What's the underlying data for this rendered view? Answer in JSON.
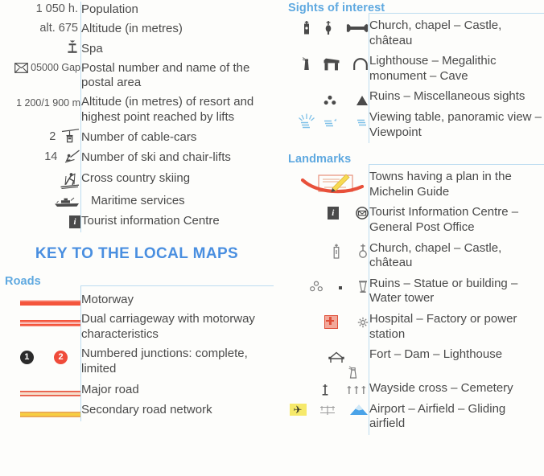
{
  "document": {
    "type": "map-legend",
    "title_local_maps": "KEY TO THE LOCAL MAPS"
  },
  "left_column": {
    "resort_rows": [
      {
        "symbol_text": "1 050 h.",
        "icon": "none",
        "label": "Population"
      },
      {
        "symbol_text": "alt. 675",
        "icon": "none",
        "label": "Altitude (in metres)"
      },
      {
        "symbol_text": "",
        "icon": "spa-fountain-icon",
        "label": "Spa"
      },
      {
        "symbol_text": "05000 Gap",
        "icon": "envelope-icon",
        "label": "Postal number and name of the postal area"
      },
      {
        "symbol_text": "1 200/1 900 m",
        "icon": "none",
        "label": "Altitude (in metres) of resort and highest point reached by lifts"
      },
      {
        "symbol_text": "2",
        "icon": "cable-car-icon",
        "label": "Number of cable-cars"
      },
      {
        "symbol_text": "14",
        "icon": "chairlift-skier-icon",
        "label": "Number of ski and chair-lifts"
      },
      {
        "symbol_text": "",
        "icon": "cross-country-skier-icon",
        "label": "Cross country skiing"
      },
      {
        "symbol_text": "",
        "icon": "ferry-boat-icon",
        "label": "Maritime services"
      },
      {
        "symbol_text": "",
        "icon": "tourist-information-icon",
        "label": "Tourist information Centre"
      }
    ],
    "roads": {
      "heading": "Roads",
      "rows": [
        {
          "icon": "motorway-swatch",
          "label": "Motorway"
        },
        {
          "icon": "dual-carriageway-swatch",
          "label": "Dual carriageway with motorway characteristics"
        },
        {
          "icon": "numbered-junction-icons",
          "junction_complete": "1",
          "junction_limited": "2",
          "label": "Numbered junctions: complete, limited"
        },
        {
          "icon": "major-road-swatch",
          "label": "Major road"
        },
        {
          "icon": "secondary-road-swatch",
          "label": "Secondary road network"
        }
      ]
    }
  },
  "right_column": {
    "sights": {
      "heading": "Sights of interest",
      "rows": [
        {
          "icons": [
            "church-icon",
            "chapel-icon",
            "castle-chateau-icon"
          ],
          "label": "Church, chapel – Castle, château"
        },
        {
          "icons": [
            "lighthouse-icon",
            "megalithic-monument-icon",
            "cave-icon"
          ],
          "label": "Lighthouse – Megalithic monument – Cave"
        },
        {
          "icons": [
            "ruins-icon",
            "miscellaneous-sights-icon"
          ],
          "label": "Ruins – Miscellaneous sights"
        },
        {
          "icons": [
            "viewing-table-icon",
            "panoramic-view-icon",
            "viewpoint-icon"
          ],
          "label": "Viewing table, panoramic view – Viewpoint"
        }
      ]
    },
    "landmarks": {
      "heading": "Landmarks",
      "rows": [
        {
          "icons": [
            "town-plan-icon"
          ],
          "label": "Towns having a plan in the Michelin Guide"
        },
        {
          "icons": [
            "tourist-information-icon",
            "post-office-icon"
          ],
          "label": "Tourist Information Centre – General Post Office"
        },
        {
          "icons": [
            "church-icon",
            "castle-chateau-icon"
          ],
          "label": "Church, chapel – Castle, château"
        },
        {
          "icons": [
            "ruins-icon",
            "statue-icon",
            "water-tower-icon"
          ],
          "label": "Ruins – Statue or building – Water tower"
        },
        {
          "icons": [
            "hospital-icon",
            "factory-power-station-icon"
          ],
          "label": "Hospital – Factory or power station"
        },
        {
          "icons": [
            "fort-icon",
            "dam-icon",
            "lighthouse-icon"
          ],
          "label": "Fort – Dam – Lighthouse"
        },
        {
          "icons": [
            "wayside-cross-icon",
            "cemetery-icon"
          ],
          "label": "Wayside cross – Cemetery"
        },
        {
          "icons": [
            "airport-icon",
            "airfield-icon",
            "gliding-airfield-icon"
          ],
          "label": "Airport – Airfield – Gliding airfield"
        }
      ]
    }
  },
  "colors": {
    "heading_blue": "#5fa9e0",
    "title_blue": "#4a8fe0",
    "rule_blue": "#bcdcf0",
    "motorway_red": "#f4553c",
    "major_road_red": "#e8604a",
    "secondary_yellow": "#f7cf3f",
    "text_gray": "#4a4a4a",
    "symbol_light_blue": "#7ec0e8",
    "hospital_red": "#e0503a",
    "airport_yellow": "#f6e96a"
  }
}
